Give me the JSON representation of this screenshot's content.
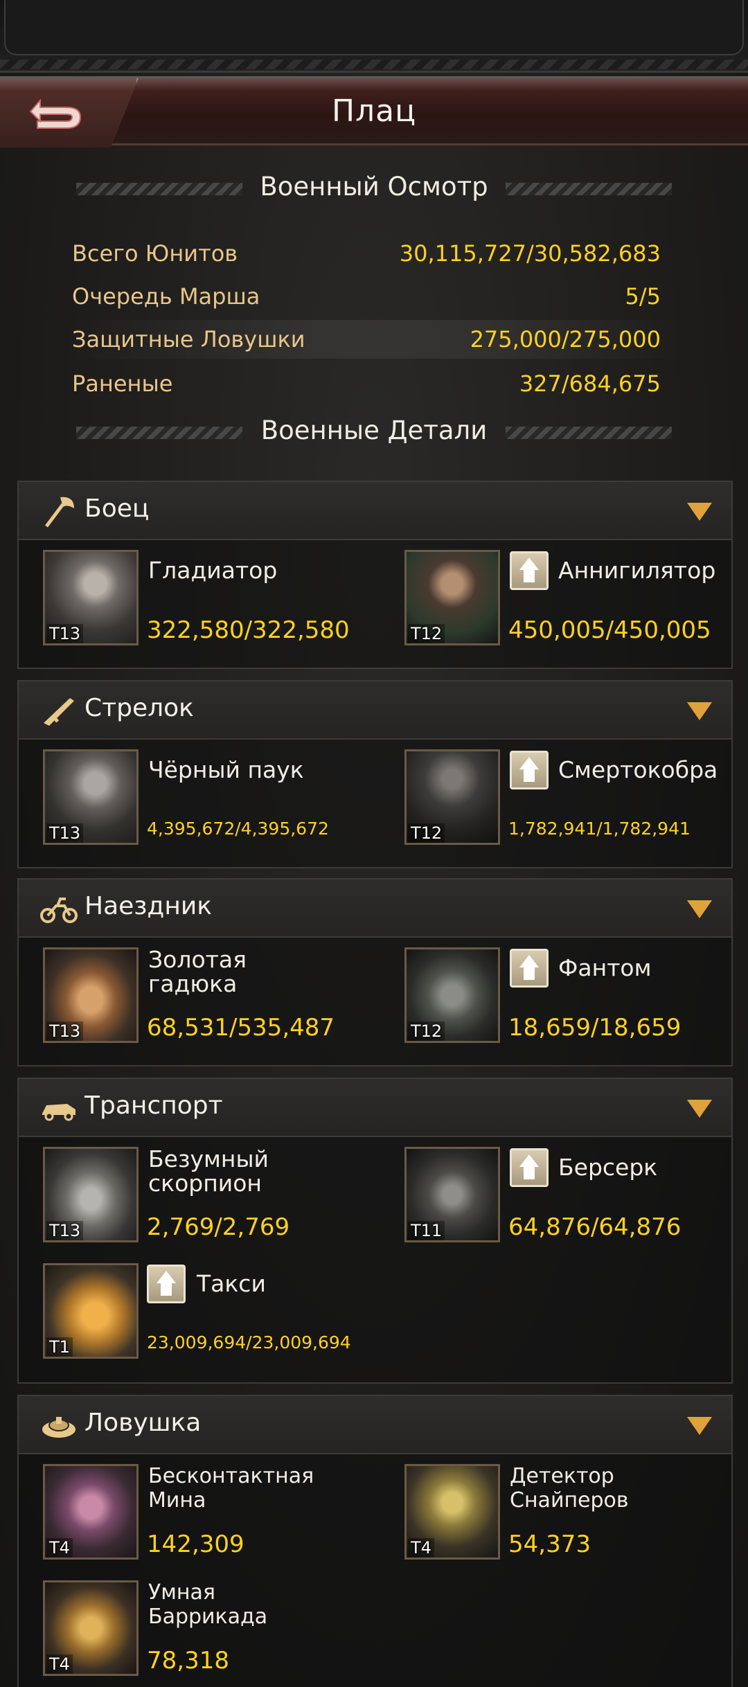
{
  "header": {
    "title": "Плац",
    "back_icon": "back-arrow-icon"
  },
  "inspection": {
    "title": "Военный Осмотр",
    "rows": [
      {
        "label": "Всего Юнитов",
        "value": "30,115,727/30,582,683"
      },
      {
        "label": "Очередь Марша",
        "value": "5/5"
      },
      {
        "label": "Защитные Ловушки",
        "value": "275,000/275,000"
      },
      {
        "label": "Раненые",
        "value": "327/684,675"
      }
    ]
  },
  "details": {
    "title": "Военные Детали"
  },
  "categories": [
    {
      "name": "Боец",
      "icon": "axe-icon",
      "units": [
        {
          "tier": "T13",
          "name": "Гладиатор",
          "count": "322,580/322,580"
        },
        {
          "tier": "T12",
          "name": "Аннигилятор",
          "count": "450,005/450,005"
        }
      ]
    },
    {
      "name": "Стрелок",
      "icon": "rifle-icon",
      "units": [
        {
          "tier": "T13",
          "name": "Чёрный паук",
          "count": "4,395,672/4,395,672"
        },
        {
          "tier": "T12",
          "name": "Смертокобра",
          "count": "1,782,941/1,782,941"
        }
      ]
    },
    {
      "name": "Наездник",
      "icon": "motorcycle-icon",
      "units": [
        {
          "tier": "T13",
          "name_line1": "Золотая",
          "name_line2": "гадюка",
          "count": "68,531/535,487"
        },
        {
          "tier": "T12",
          "name": "Фантом",
          "count": "18,659/18,659"
        }
      ]
    },
    {
      "name": "Транспорт",
      "icon": "car-icon",
      "units": [
        {
          "tier": "T13",
          "name_line1": "Безумный",
          "name_line2": "скорпион",
          "count": "2,769/2,769"
        },
        {
          "tier": "T11",
          "name": "Берсерк",
          "count": "64,876/64,876"
        },
        {
          "tier": "T1",
          "name": "Такси",
          "count": "23,009,694/23,009,694"
        }
      ]
    },
    {
      "name": "Ловушка",
      "icon": "landmine-icon",
      "units": [
        {
          "tier": "T4",
          "name_line1": "Бесконтактная",
          "name_line2": "Мина",
          "count": "142,309"
        },
        {
          "tier": "T4",
          "name_line1": "Детектор",
          "name_line2": "Снайперов",
          "count": "54,373"
        },
        {
          "tier": "T4",
          "name_line1": "Умная",
          "name_line2": "Баррикада",
          "count": "78,318"
        }
      ]
    }
  ],
  "colors": {
    "accent_gold": "#ffd21f",
    "label_tan": "#e8c68a",
    "toggle_orange": "#e0a23a"
  }
}
